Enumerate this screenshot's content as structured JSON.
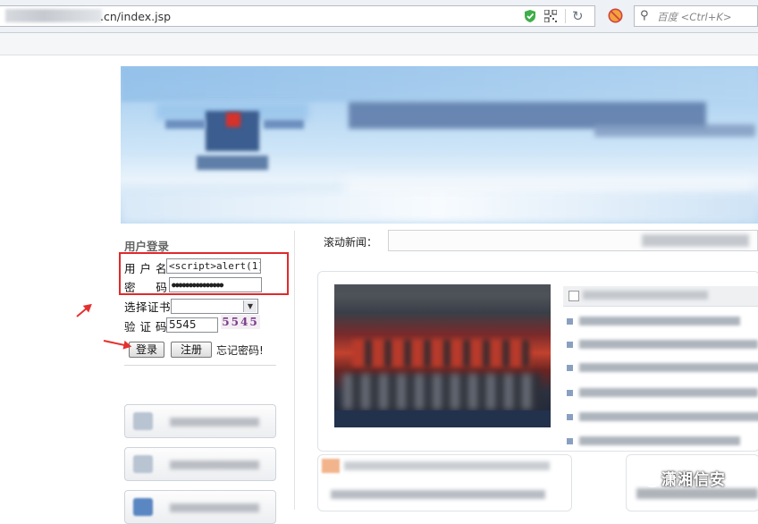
{
  "browser": {
    "url": ".cn/index.jsp",
    "search_placeholder": "百度 <Ctrl+K>"
  },
  "login": {
    "title": "用户登录",
    "username_label": "用 户 名",
    "username_value": "<script>alert(1)</",
    "password_label": "密     码",
    "password_value": "●●●●●●●●●●●●●●●",
    "cert_label": "选择证书",
    "cert_value": "",
    "captcha_label": "验 证 码",
    "captcha_value": "5545",
    "captcha_image_text": "5545",
    "login_button": "登录",
    "register_button": "注册",
    "forgot_link": "忘记密码!"
  },
  "news": {
    "scroll_label": "滚动新闻："
  },
  "watermark": {
    "text": "潇湘信安"
  },
  "colors": {
    "highlight_box": "#e02a2a",
    "arrow": "#e53030"
  }
}
